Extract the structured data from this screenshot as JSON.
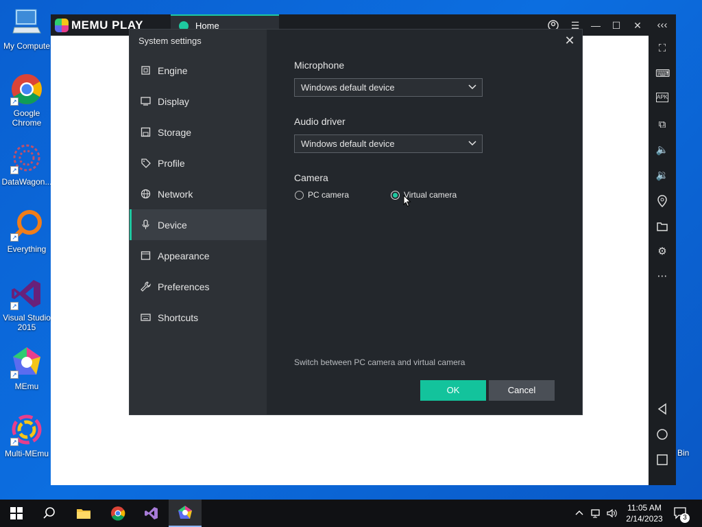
{
  "desktop": {
    "icons": [
      {
        "label": "My Compute",
        "icon": "computer-icon"
      },
      {
        "label": "Google Chrome",
        "icon": "chrome-icon"
      },
      {
        "label": "DataWagon...",
        "icon": "datawagon-icon"
      },
      {
        "label": "Everything",
        "icon": "everything-search-icon"
      },
      {
        "label": "Visual Studio 2015",
        "icon": "visual-studio-icon"
      },
      {
        "label": "MEmu",
        "icon": "memu-icon"
      },
      {
        "label": "Multi-MEmu",
        "icon": "multi-memu-icon"
      }
    ],
    "recycle_label": "Bin"
  },
  "memu": {
    "brand": "MEMU PLAY",
    "tab_label": "Home"
  },
  "dialog": {
    "title": "System settings",
    "nav": [
      {
        "label": "Engine",
        "icon": "chip-icon"
      },
      {
        "label": "Display",
        "icon": "monitor-icon"
      },
      {
        "label": "Storage",
        "icon": "storage-icon"
      },
      {
        "label": "Profile",
        "icon": "tag-icon"
      },
      {
        "label": "Network",
        "icon": "globe-icon"
      },
      {
        "label": "Device",
        "icon": "microphone-icon",
        "active": true
      },
      {
        "label": "Appearance",
        "icon": "window-icon"
      },
      {
        "label": "Preferences",
        "icon": "wrench-icon"
      },
      {
        "label": "Shortcuts",
        "icon": "keyboard-icon"
      }
    ],
    "microphone": {
      "label": "Microphone",
      "value": "Windows default device"
    },
    "audio_driver": {
      "label": "Audio driver",
      "value": "Windows default device"
    },
    "camera": {
      "label": "Camera",
      "options": [
        {
          "label": "PC camera",
          "selected": false
        },
        {
          "label": "Virtual camera",
          "selected": true
        }
      ]
    },
    "hint": "Switch between PC camera and virtual camera",
    "ok_label": "OK",
    "cancel_label": "Cancel"
  },
  "taskbar": {
    "time": "11:05 AM",
    "date": "2/14/2023",
    "notification_count": "3"
  },
  "colors": {
    "accent": "#13c39c",
    "desktop": "#0a5fd0",
    "dialog_bg": "#23272c",
    "nav_bg": "#2d3136"
  }
}
